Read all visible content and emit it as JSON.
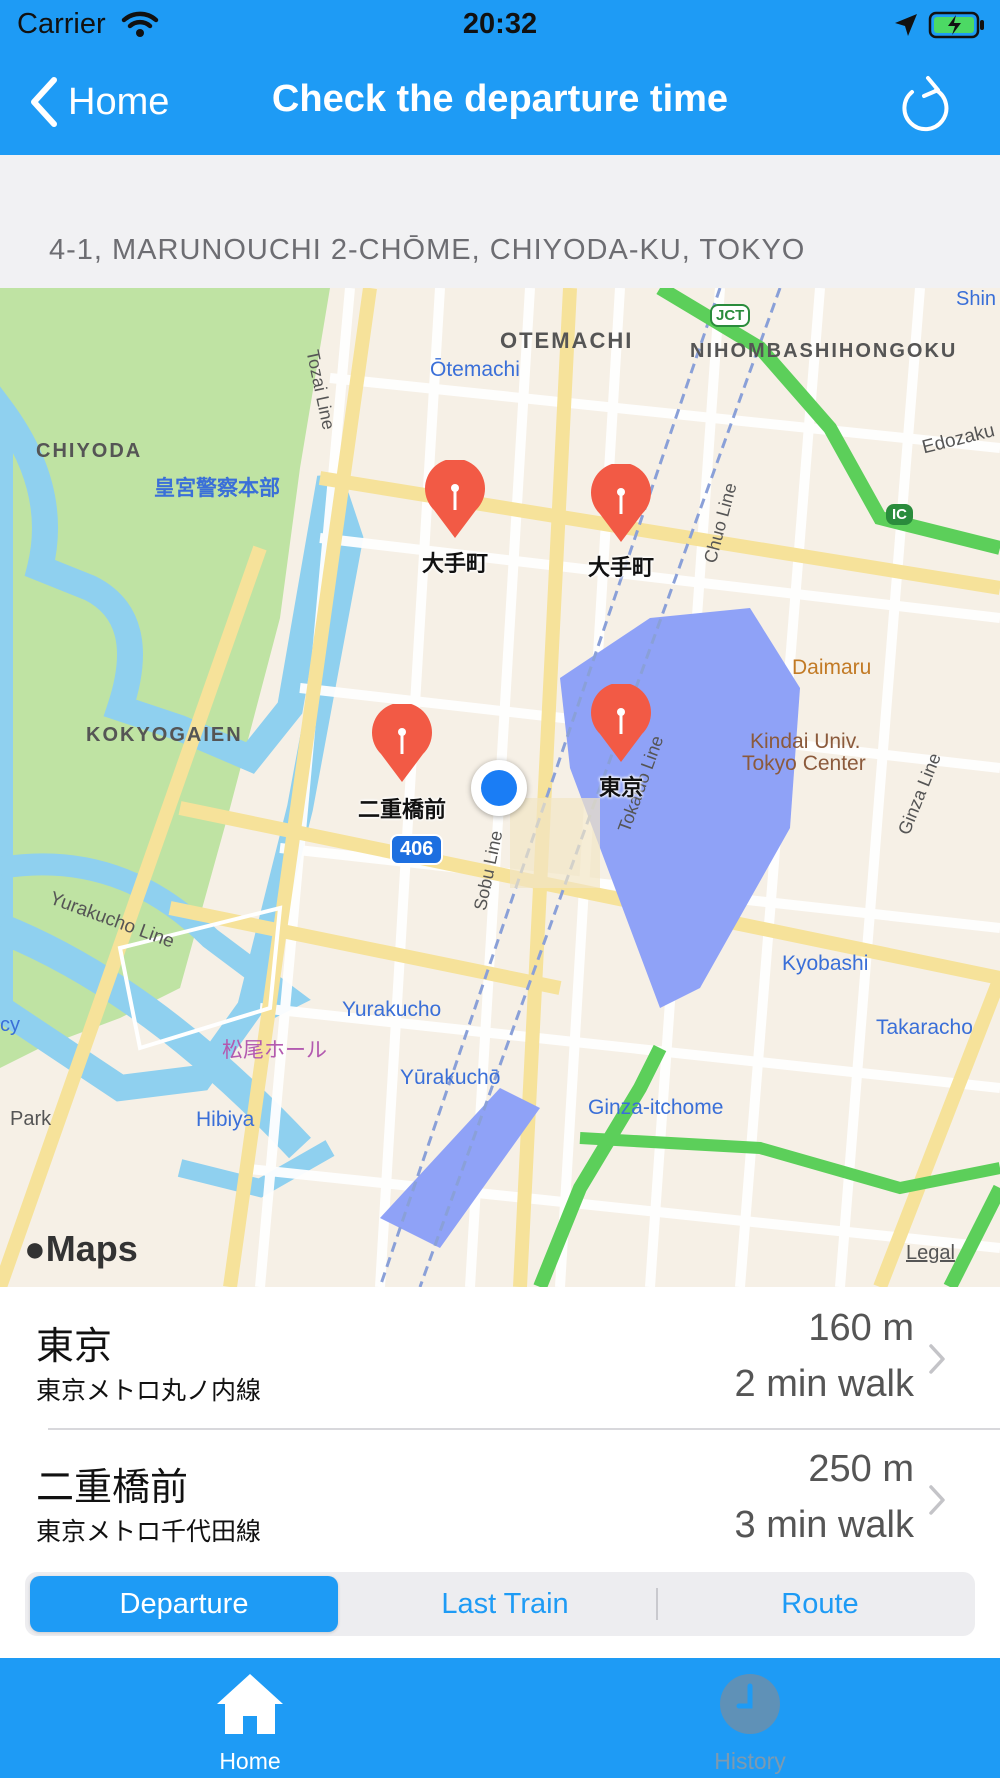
{
  "status_bar": {
    "carrier": "Carrier",
    "time": "20:32"
  },
  "nav": {
    "back_label": "Home",
    "title": "Check the departure time"
  },
  "address": "4-1, MARUNOUCHI 2-CHŌME, CHIYODA-KU, TOKYO",
  "map": {
    "labels": {
      "otemachi_area": "OTEMACHI",
      "otemachi_station": "Ōtemachi",
      "nihombashi": "NIHOMBASHIHONGOKU",
      "shin": "Shin",
      "chiyoda": "CHIYODA",
      "police_hq": "皇宮警察本部",
      "kokyogaien": "KOKYOGAIEN",
      "daimaru": "Daimaru",
      "kindai_1": "Kindai Univ.",
      "kindai_2": "Tokyo Center",
      "route_406": "406",
      "yurakucho": "Yurakucho",
      "yurakucho_station": "Yūrakuchō",
      "matsuo_hall": "松尾ホール",
      "hibiya": "Hibiya",
      "kyobashi": "Kyobashi",
      "takaracho": "Takaracho",
      "ginza_itchome": "Ginza-itchome",
      "park": "Park",
      "cy": "cy",
      "tozai_line": "Tozai Line",
      "chuo_line": "Chuo Line",
      "tokaido_line": "Tokaido Line",
      "sobu_line": "Sobu Line",
      "ginza_line": "Ginza Line",
      "yurakucho_line": "Yurakucho Line",
      "edozaki": "Edozaku",
      "jct": "JCT",
      "ic": "IC"
    },
    "pins": [
      {
        "label": "大手町"
      },
      {
        "label": "大手町"
      },
      {
        "label": "東京"
      },
      {
        "label": "二重橋前"
      }
    ],
    "maps_logo": "Maps",
    "legal": "Legal"
  },
  "stations": [
    {
      "name": "東京",
      "line": "東京メトロ丸ノ内線",
      "distance": "160 m",
      "walk": "2 min walk"
    },
    {
      "name": "二重橋前",
      "line": "東京メトロ千代田線",
      "distance": "250 m",
      "walk": "3 min walk"
    }
  ],
  "segments": [
    {
      "label": "Departure",
      "selected": true
    },
    {
      "label": "Last Train",
      "selected": false
    },
    {
      "label": "Route",
      "selected": false
    }
  ],
  "tabs": [
    {
      "label": "Home",
      "icon": "home-icon",
      "selected": true
    },
    {
      "label": "History",
      "icon": "clock-icon",
      "selected": false
    }
  ],
  "colors": {
    "brand_blue": "#1e9bf5",
    "pin_red": "#f25a45",
    "park_green": "#bfe3a3",
    "water_blue": "#8fd0ef",
    "station_purple": "#8fa2f7",
    "expressway_green": "#5ccf5a"
  }
}
